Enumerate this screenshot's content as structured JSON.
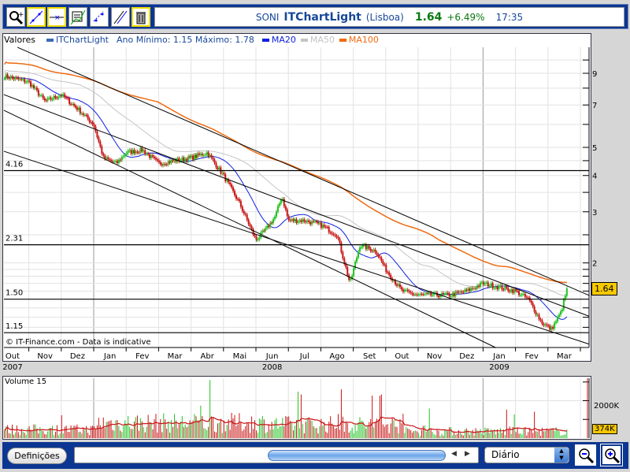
{
  "toolbar": {
    "tools": [
      "zoom-tool",
      "trendline-tool",
      "horizontal-line-tool",
      "indicators-tool",
      "parallel-channel-tool",
      "fibonacci-tool",
      "delete-tool"
    ]
  },
  "header": {
    "symbol": "SONI",
    "app": "ITChartLight",
    "market": "(Lisboa)",
    "price": "1.64",
    "change": "+6.49%",
    "time": "17:35"
  },
  "legend": {
    "label": "Valores",
    "series": "ITChartLight",
    "range": "Ano Mínimo: 1.15 Máximo: 1.78",
    "ma20": "MA20",
    "ma50": "MA50",
    "ma100": "MA100"
  },
  "colors": {
    "up": "#22c322",
    "down": "#c81414",
    "ma20": "#1020e0",
    "ma50": "#c4c4c4",
    "ma100": "#f06a10",
    "series": "#3a6ab8"
  },
  "credit": "© IT-Finance.com - Data is indicative",
  "chart_data": {
    "type": "candlestick",
    "scale": "log",
    "yticks": [
      2,
      3,
      4,
      5,
      7,
      9
    ],
    "ylim": [
      1.0,
      11.5
    ],
    "current_price_label": "1.64",
    "xticks": [
      "Out",
      "Nov",
      "Dez",
      "Jan",
      "Fev",
      "Mar",
      "Abr",
      "Mai",
      "Jun",
      "Jul",
      "Ago",
      "Set",
      "Out",
      "Nov",
      "Dez",
      "Jan",
      "Fev",
      "Mar"
    ],
    "years": [
      {
        "label": "2007",
        "month": 1
      },
      {
        "label": "2008",
        "month": 9
      },
      {
        "label": "2009",
        "month": 16
      }
    ],
    "price_path": [
      [
        0.25,
        8.8
      ],
      [
        1,
        8.4
      ],
      [
        1.5,
        7.2
      ],
      [
        2,
        7.6
      ],
      [
        2.5,
        6.8
      ],
      [
        3,
        6.0
      ],
      [
        3.3,
        4.6
      ],
      [
        3.7,
        4.4
      ],
      [
        4,
        4.8
      ],
      [
        4.5,
        4.9
      ],
      [
        5,
        4.4
      ],
      [
        5.5,
        4.5
      ],
      [
        6,
        4.6
      ],
      [
        6.5,
        4.8
      ],
      [
        7,
        4.0
      ],
      [
        7.5,
        3.2
      ],
      [
        8,
        2.4
      ],
      [
        8.3,
        2.6
      ],
      [
        8.6,
        2.9
      ],
      [
        8.8,
        3.4
      ],
      [
        9,
        2.8
      ],
      [
        9.5,
        2.8
      ],
      [
        10,
        2.7
      ],
      [
        10.5,
        2.5
      ],
      [
        10.9,
        1.7
      ],
      [
        11.2,
        2.3
      ],
      [
        11.7,
        2.2
      ],
      [
        12,
        1.9
      ],
      [
        12.5,
        1.6
      ],
      [
        13,
        1.55
      ],
      [
        13.5,
        1.55
      ],
      [
        14,
        1.55
      ],
      [
        14.5,
        1.6
      ],
      [
        15,
        1.7
      ],
      [
        15.5,
        1.65
      ],
      [
        16,
        1.6
      ],
      [
        16.4,
        1.5
      ],
      [
        16.8,
        1.25
      ],
      [
        17.1,
        1.18
      ],
      [
        17.4,
        1.35
      ],
      [
        17.6,
        1.64
      ]
    ],
    "hlines": [
      {
        "value": 4.16,
        "label": "4.16"
      },
      {
        "value": 2.31,
        "label": "2.31"
      },
      {
        "value": 1.5,
        "label": "1.50"
      },
      {
        "value": 1.15,
        "label": "1.15"
      }
    ],
    "trendlines": [
      [
        [
          0.65,
          11.06
        ],
        [
          18.27,
          1.545
        ]
      ],
      [
        [
          0.23,
          7.6
        ],
        [
          18.27,
          1.31
        ]
      ],
      [
        [
          0.23,
          6.71
        ],
        [
          15.4,
          1.02
        ]
      ],
      [
        [
          0.23,
          4.85
        ],
        [
          18.27,
          1.05
        ]
      ]
    ],
    "volume": {
      "title": "Volume 15",
      "ytick": "2000K",
      "current_label": "374K",
      "ymax": 3200
    }
  },
  "bottom": {
    "settings": "Definições",
    "period": "Diário"
  }
}
